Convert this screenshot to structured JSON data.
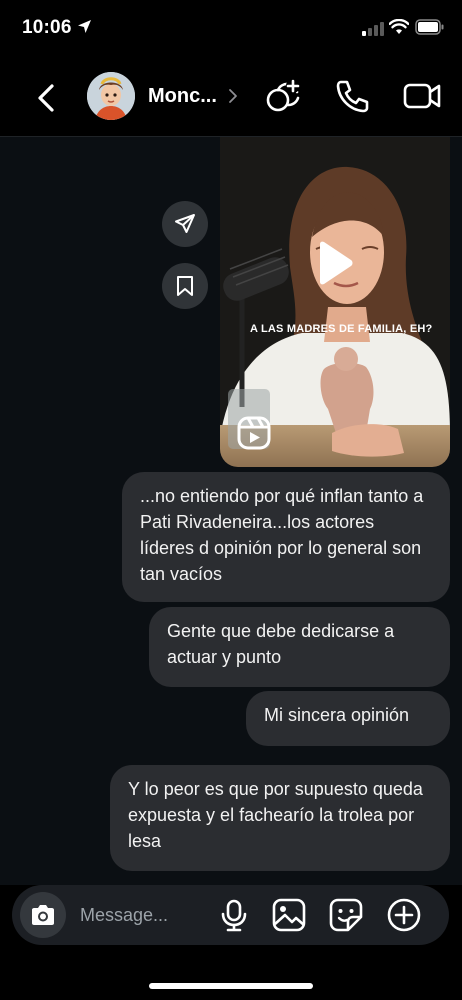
{
  "status_bar": {
    "time": "10:06"
  },
  "header": {
    "contact_name": "Monc..."
  },
  "reel": {
    "caption": "A LAS MADRES DE FAMILIA, EH?"
  },
  "messages": [
    {
      "text": "...no entiendo por qué inflan tanto a Pati Rivadeneira...los actores líderes d opinión por lo general son tan vacíos"
    },
    {
      "text": "Gente que debe dedicarse a actuar y punto"
    },
    {
      "text": "Mi sincera opinión"
    },
    {
      "text": "Y lo peor es que por supuesto queda expuesta y el fachearío la trolea por lesa"
    }
  ],
  "composer": {
    "placeholder": "Message..."
  },
  "colors": {
    "background": "#000000",
    "chat_background": "#0b0f13",
    "bubble": "#2b2d31",
    "round_button": "#303438"
  }
}
